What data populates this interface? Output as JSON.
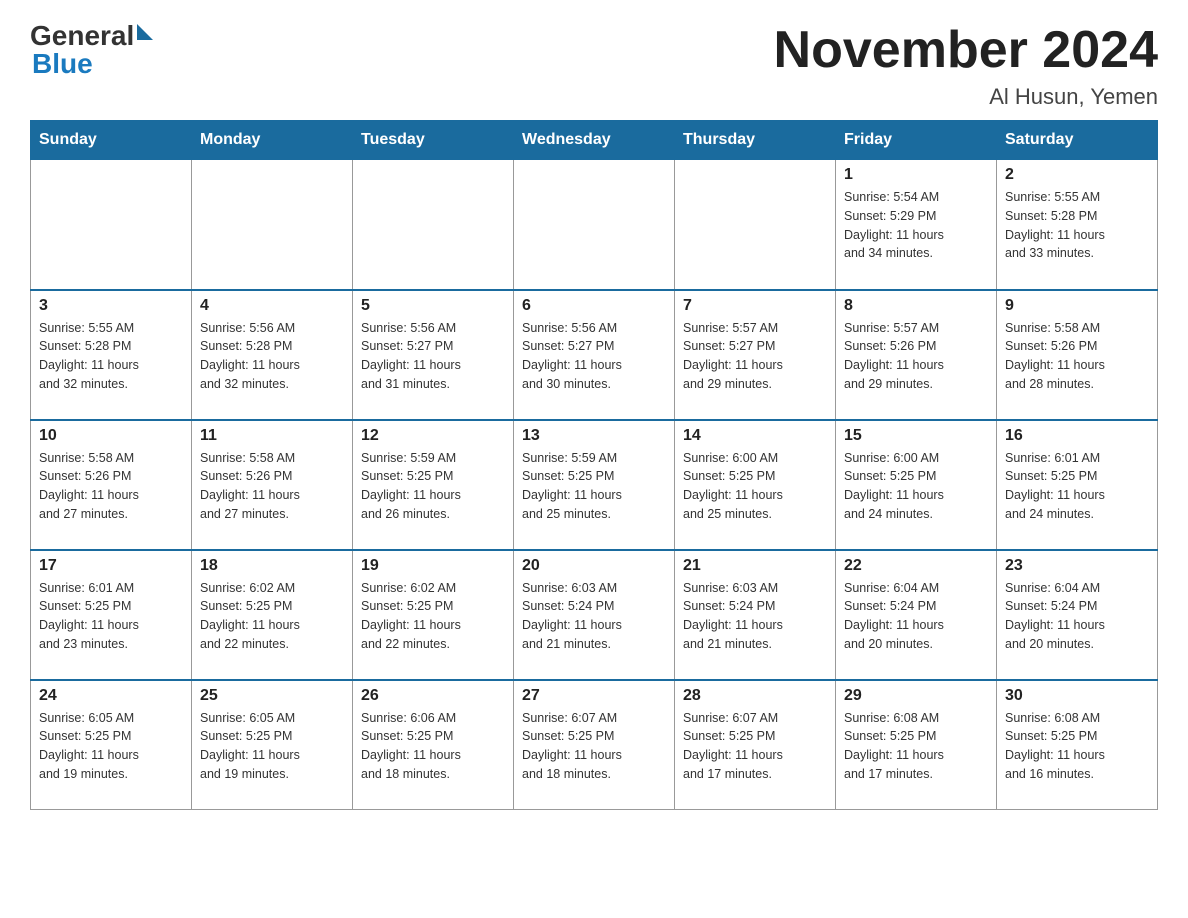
{
  "header": {
    "logo": {
      "general": "General",
      "blue": "Blue"
    },
    "title": "November 2024",
    "subtitle": "Al Husun, Yemen"
  },
  "weekdays": [
    "Sunday",
    "Monday",
    "Tuesday",
    "Wednesday",
    "Thursday",
    "Friday",
    "Saturday"
  ],
  "weeks": [
    {
      "days": [
        {
          "number": "",
          "info": ""
        },
        {
          "number": "",
          "info": ""
        },
        {
          "number": "",
          "info": ""
        },
        {
          "number": "",
          "info": ""
        },
        {
          "number": "",
          "info": ""
        },
        {
          "number": "1",
          "info": "Sunrise: 5:54 AM\nSunset: 5:29 PM\nDaylight: 11 hours\nand 34 minutes."
        },
        {
          "number": "2",
          "info": "Sunrise: 5:55 AM\nSunset: 5:28 PM\nDaylight: 11 hours\nand 33 minutes."
        }
      ]
    },
    {
      "days": [
        {
          "number": "3",
          "info": "Sunrise: 5:55 AM\nSunset: 5:28 PM\nDaylight: 11 hours\nand 32 minutes."
        },
        {
          "number": "4",
          "info": "Sunrise: 5:56 AM\nSunset: 5:28 PM\nDaylight: 11 hours\nand 32 minutes."
        },
        {
          "number": "5",
          "info": "Sunrise: 5:56 AM\nSunset: 5:27 PM\nDaylight: 11 hours\nand 31 minutes."
        },
        {
          "number": "6",
          "info": "Sunrise: 5:56 AM\nSunset: 5:27 PM\nDaylight: 11 hours\nand 30 minutes."
        },
        {
          "number": "7",
          "info": "Sunrise: 5:57 AM\nSunset: 5:27 PM\nDaylight: 11 hours\nand 29 minutes."
        },
        {
          "number": "8",
          "info": "Sunrise: 5:57 AM\nSunset: 5:26 PM\nDaylight: 11 hours\nand 29 minutes."
        },
        {
          "number": "9",
          "info": "Sunrise: 5:58 AM\nSunset: 5:26 PM\nDaylight: 11 hours\nand 28 minutes."
        }
      ]
    },
    {
      "days": [
        {
          "number": "10",
          "info": "Sunrise: 5:58 AM\nSunset: 5:26 PM\nDaylight: 11 hours\nand 27 minutes."
        },
        {
          "number": "11",
          "info": "Sunrise: 5:58 AM\nSunset: 5:26 PM\nDaylight: 11 hours\nand 27 minutes."
        },
        {
          "number": "12",
          "info": "Sunrise: 5:59 AM\nSunset: 5:25 PM\nDaylight: 11 hours\nand 26 minutes."
        },
        {
          "number": "13",
          "info": "Sunrise: 5:59 AM\nSunset: 5:25 PM\nDaylight: 11 hours\nand 25 minutes."
        },
        {
          "number": "14",
          "info": "Sunrise: 6:00 AM\nSunset: 5:25 PM\nDaylight: 11 hours\nand 25 minutes."
        },
        {
          "number": "15",
          "info": "Sunrise: 6:00 AM\nSunset: 5:25 PM\nDaylight: 11 hours\nand 24 minutes."
        },
        {
          "number": "16",
          "info": "Sunrise: 6:01 AM\nSunset: 5:25 PM\nDaylight: 11 hours\nand 24 minutes."
        }
      ]
    },
    {
      "days": [
        {
          "number": "17",
          "info": "Sunrise: 6:01 AM\nSunset: 5:25 PM\nDaylight: 11 hours\nand 23 minutes."
        },
        {
          "number": "18",
          "info": "Sunrise: 6:02 AM\nSunset: 5:25 PM\nDaylight: 11 hours\nand 22 minutes."
        },
        {
          "number": "19",
          "info": "Sunrise: 6:02 AM\nSunset: 5:25 PM\nDaylight: 11 hours\nand 22 minutes."
        },
        {
          "number": "20",
          "info": "Sunrise: 6:03 AM\nSunset: 5:24 PM\nDaylight: 11 hours\nand 21 minutes."
        },
        {
          "number": "21",
          "info": "Sunrise: 6:03 AM\nSunset: 5:24 PM\nDaylight: 11 hours\nand 21 minutes."
        },
        {
          "number": "22",
          "info": "Sunrise: 6:04 AM\nSunset: 5:24 PM\nDaylight: 11 hours\nand 20 minutes."
        },
        {
          "number": "23",
          "info": "Sunrise: 6:04 AM\nSunset: 5:24 PM\nDaylight: 11 hours\nand 20 minutes."
        }
      ]
    },
    {
      "days": [
        {
          "number": "24",
          "info": "Sunrise: 6:05 AM\nSunset: 5:25 PM\nDaylight: 11 hours\nand 19 minutes."
        },
        {
          "number": "25",
          "info": "Sunrise: 6:05 AM\nSunset: 5:25 PM\nDaylight: 11 hours\nand 19 minutes."
        },
        {
          "number": "26",
          "info": "Sunrise: 6:06 AM\nSunset: 5:25 PM\nDaylight: 11 hours\nand 18 minutes."
        },
        {
          "number": "27",
          "info": "Sunrise: 6:07 AM\nSunset: 5:25 PM\nDaylight: 11 hours\nand 18 minutes."
        },
        {
          "number": "28",
          "info": "Sunrise: 6:07 AM\nSunset: 5:25 PM\nDaylight: 11 hours\nand 17 minutes."
        },
        {
          "number": "29",
          "info": "Sunrise: 6:08 AM\nSunset: 5:25 PM\nDaylight: 11 hours\nand 17 minutes."
        },
        {
          "number": "30",
          "info": "Sunrise: 6:08 AM\nSunset: 5:25 PM\nDaylight: 11 hours\nand 16 minutes."
        }
      ]
    }
  ]
}
